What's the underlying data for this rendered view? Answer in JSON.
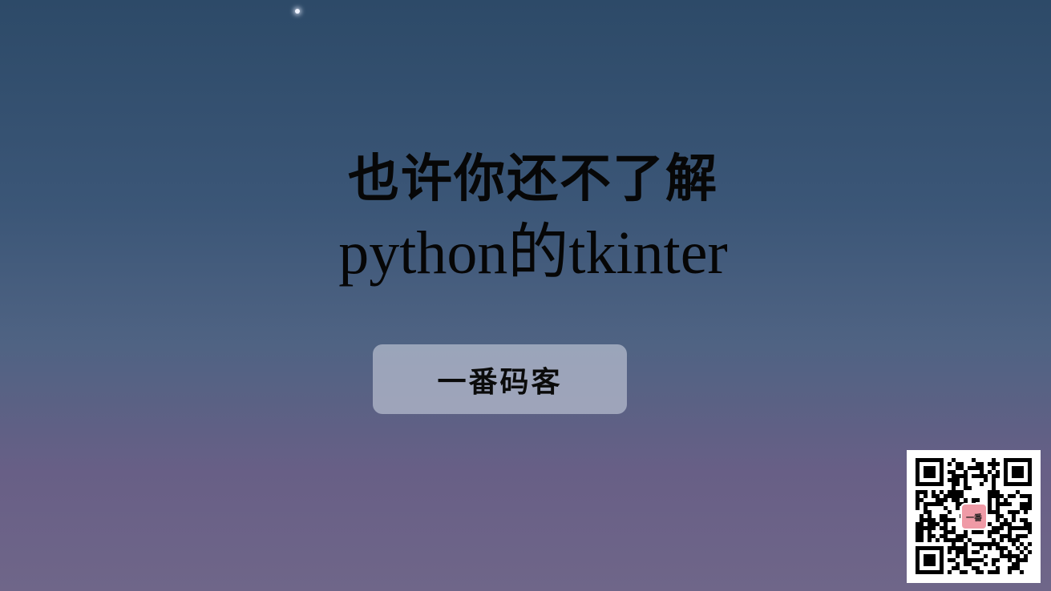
{
  "title": {
    "line1": "也许你还不了解",
    "line2": "python的tkinter"
  },
  "brand": {
    "label": "一番码客"
  },
  "qr": {
    "logo_text": "一番"
  },
  "icons": {
    "star": "star-icon",
    "qr": "qr-code-icon"
  },
  "colors": {
    "sky_top": "#2d4a68",
    "sky_bottom": "#6f6689",
    "text": "#070707",
    "button_bg": "#bec4d4",
    "qr_logo": "#ef9aa6"
  }
}
